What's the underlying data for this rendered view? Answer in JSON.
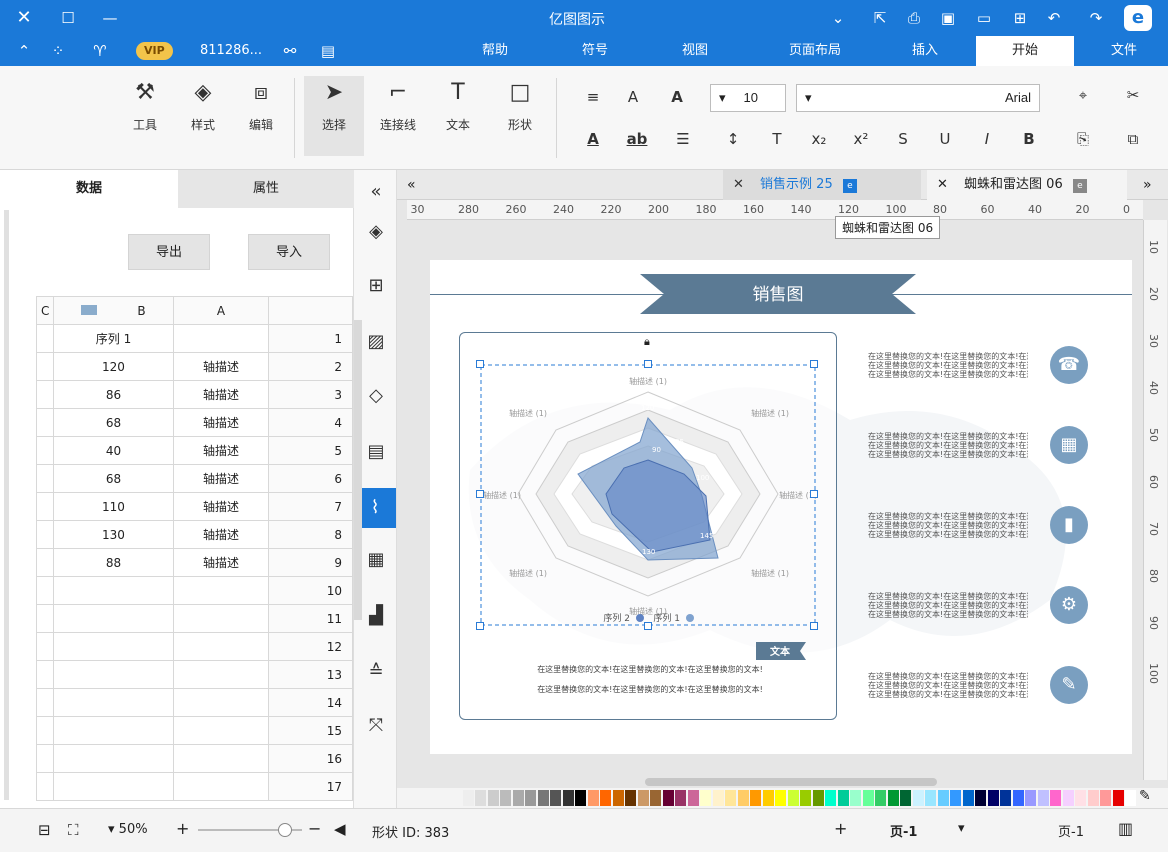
{
  "app": {
    "title": "亿图图示"
  },
  "titlebar": {
    "user": "811286...",
    "vip": "VIP"
  },
  "menu": {
    "file": "文件",
    "start": "开始",
    "insert": "插入",
    "layout": "页面布局",
    "view": "视图",
    "symbol": "符号",
    "help": "帮助"
  },
  "ribbon": {
    "select_label": "选择",
    "connector_label": "连接线",
    "text_label": "文本",
    "shape_label": "形状",
    "tools_label": "工具",
    "style_label": "样式",
    "edit_label": "编辑",
    "font_name": "Arial",
    "font_size": "10"
  },
  "left_panel": {
    "tab_data": "数据",
    "tab_props": "属性",
    "import_label": "导入",
    "export_label": "导出",
    "col_a": "A",
    "col_b": "B",
    "col_c": "C",
    "rows": [
      {
        "n": "1",
        "a": "",
        "b": "序列 1"
      },
      {
        "n": "2",
        "a": "轴描述",
        "b": "120"
      },
      {
        "n": "3",
        "a": "轴描述",
        "b": "86"
      },
      {
        "n": "4",
        "a": "轴描述",
        "b": "68"
      },
      {
        "n": "5",
        "a": "轴描述",
        "b": "40"
      },
      {
        "n": "6",
        "a": "轴描述",
        "b": "68"
      },
      {
        "n": "7",
        "a": "轴描述",
        "b": "110"
      },
      {
        "n": "8",
        "a": "轴描述",
        "b": "130"
      },
      {
        "n": "9",
        "a": "轴描述",
        "b": "88"
      },
      {
        "n": "10",
        "a": "",
        "b": ""
      },
      {
        "n": "11",
        "a": "",
        "b": ""
      },
      {
        "n": "12",
        "a": "",
        "b": ""
      },
      {
        "n": "13",
        "a": "",
        "b": ""
      },
      {
        "n": "14",
        "a": "",
        "b": ""
      },
      {
        "n": "15",
        "a": "",
        "b": ""
      },
      {
        "n": "16",
        "a": "",
        "b": ""
      },
      {
        "n": "17",
        "a": "",
        "b": ""
      }
    ]
  },
  "doc_tabs": {
    "tab1": "蜘蛛和雷达图 06",
    "tab2": "销售示例 25",
    "tooltip": "蜘蛛和雷达图 06"
  },
  "ruler": {
    "top": [
      "0",
      "20",
      "40",
      "60",
      "80",
      "100",
      "120",
      "140",
      "160",
      "180",
      "200",
      "220",
      "240",
      "260",
      "280",
      "30"
    ],
    "left": [
      "10",
      "20",
      "30",
      "40",
      "50",
      "60",
      "70",
      "80",
      "90",
      "100"
    ]
  },
  "slide": {
    "banner": "销售图",
    "caption_badge": "文本",
    "caption_line1": "在这里替换您的文本!在这里替换您的文本!在这里替换您的文本!",
    "caption_line2": "在这里替换您的文本!在这里替换您的文本!在这里替换您的文本!",
    "legend1": "序列 1",
    "legend2": "序列 2",
    "axis_label": "轴描述 (1)",
    "tick_labels": [
      "120",
      "85",
      "90",
      "100",
      "145",
      "130",
      "135"
    ],
    "info_text": "在这里替换您的文本!在这里替换您的文本!在这里替换您的文本!",
    "icons": [
      "contacts-icon",
      "calendar-icon",
      "bar-chart-icon",
      "gear-icon",
      "pencil-icon"
    ]
  },
  "status": {
    "page_nav": "页-1",
    "page_name": "页-1",
    "shape_id": "形状 ID: 383",
    "zoom": "50%"
  },
  "colors": {
    "brand": "#1b79d8",
    "banner": "#5b7a94",
    "radar1": "#7fa2cf",
    "radar2": "#5f83c4",
    "icon": "#7a9fc0"
  }
}
